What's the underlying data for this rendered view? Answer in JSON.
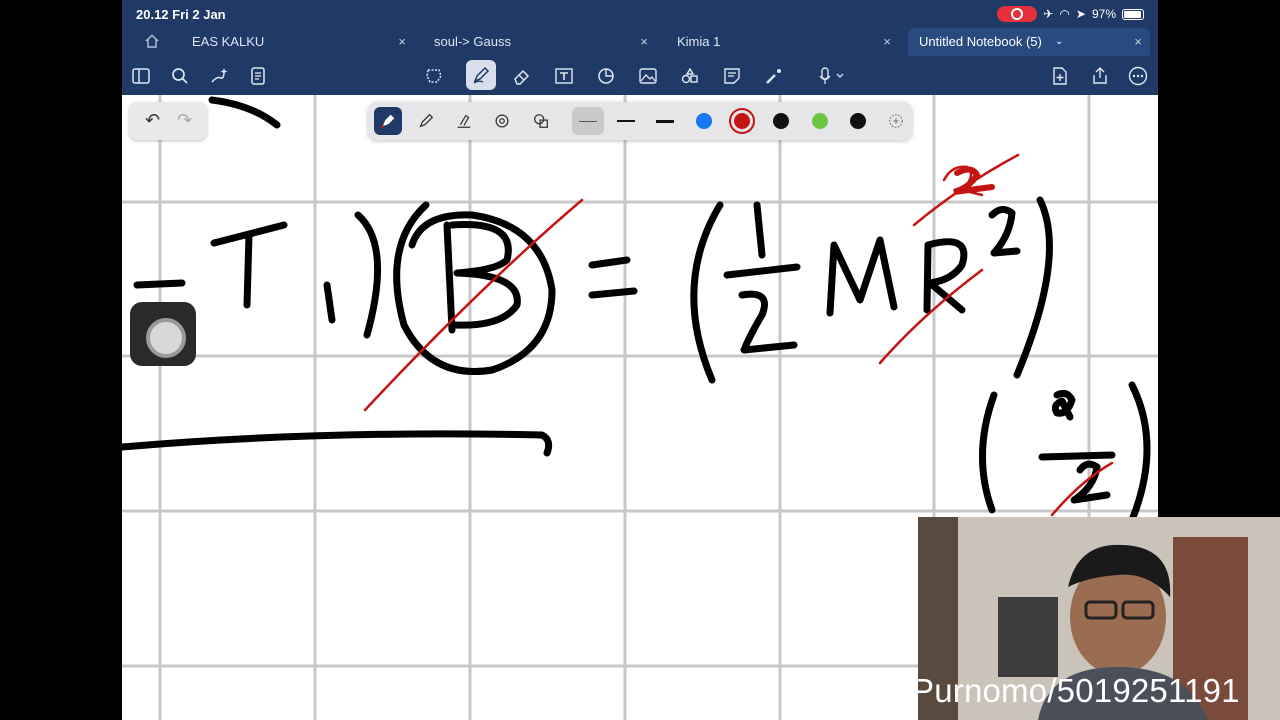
{
  "status": {
    "time_date": "20.12  Fri 2 Jan",
    "battery": "97%"
  },
  "tabs": [
    {
      "label": "EAS KALKU"
    },
    {
      "label": "soul-> Gauss"
    },
    {
      "label": "Kimia 1"
    },
    {
      "label": "Untitled Notebook (5)"
    }
  ],
  "tab_close_glyph": "×",
  "palette": {
    "colors": [
      "#1877f2",
      "#c41414",
      "#111111",
      "#6cc644",
      "#111111"
    ],
    "selected_color": "#c41414"
  },
  "undo": {
    "undo_glyph": "↶",
    "redo_glyph": "↷"
  },
  "watermark": "Purnomo/5019251191",
  "theme": {
    "header_bg": "#1f3a66",
    "ink": "#000000",
    "annotation_red": "#c41414",
    "grid": "#c8c8c8"
  }
}
